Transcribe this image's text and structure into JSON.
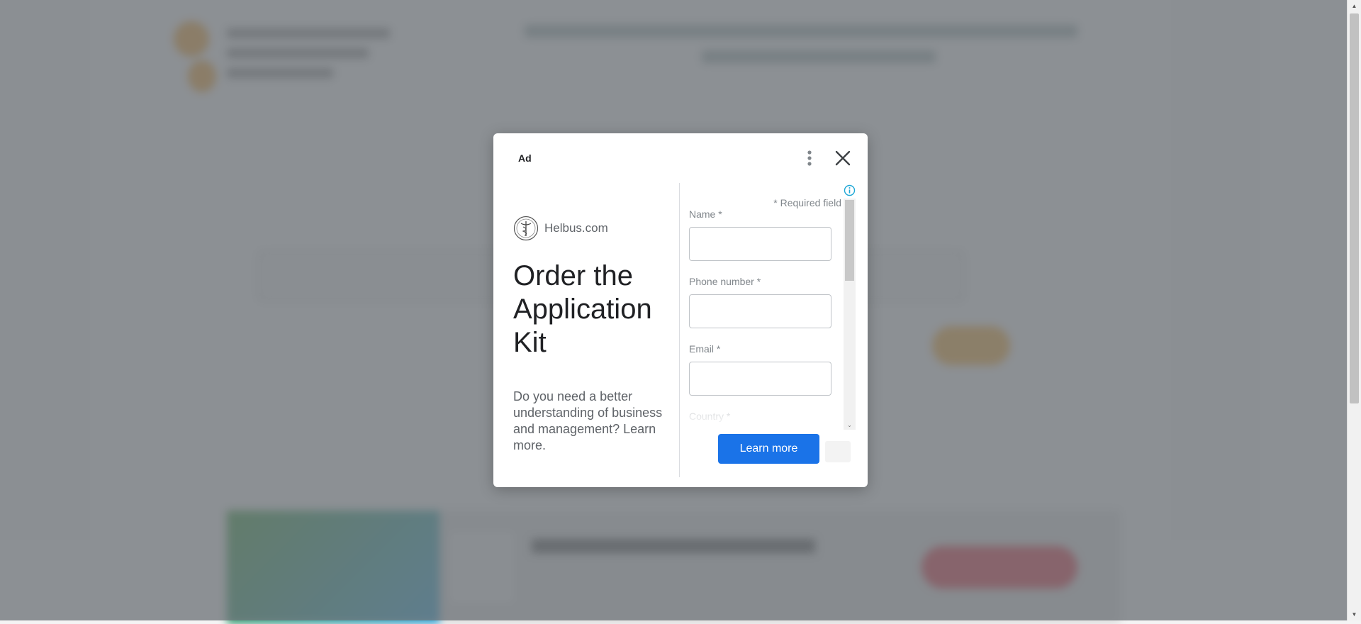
{
  "ad": {
    "label": "Ad",
    "advertiser": "Helbus.com",
    "headline": "Order the Application Kit",
    "description": "Do you need a better understanding of business and management? Learn more.",
    "cta_label": "Learn more",
    "icons": {
      "more": "more-vert-icon",
      "close": "close-icon",
      "info": "info-icon",
      "logo": "caduceus-logo-icon"
    },
    "form": {
      "required_note": "* Required field",
      "fields": [
        {
          "label": "Name *",
          "value": ""
        },
        {
          "label": "Phone number *",
          "value": ""
        },
        {
          "label": "Email *",
          "value": ""
        },
        {
          "label": "Country *",
          "value": ""
        }
      ]
    }
  },
  "colors": {
    "cta": "#1a73e8",
    "overlay": "#6e7378",
    "info": "#1ea7d6"
  }
}
